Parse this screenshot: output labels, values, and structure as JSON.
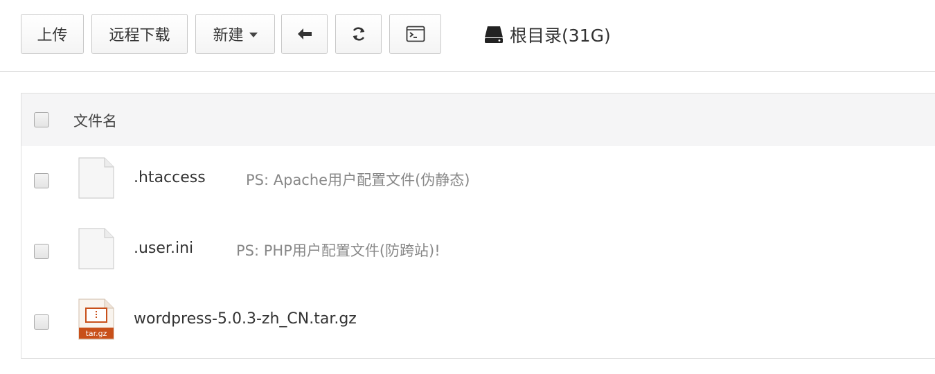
{
  "toolbar": {
    "upload_label": "上传",
    "remote_download_label": "远程下载",
    "new_label": "新建",
    "back_icon": "arrow-left-icon",
    "refresh_icon": "refresh-icon",
    "terminal_icon": "terminal-icon",
    "path_icon": "hdd-icon",
    "path_label": "根目录(31G)"
  },
  "table": {
    "header": {
      "name_label": "文件名"
    },
    "rows": [
      {
        "name": ".htaccess",
        "note": "PS: Apache用户配置文件(伪静态)",
        "icon": "file-icon"
      },
      {
        "name": ".user.ini",
        "note": "PS: PHP用户配置文件(防跨站)!",
        "icon": "file-icon"
      },
      {
        "name": "wordpress-5.0.3-zh_CN.tar.gz",
        "note": "",
        "icon": "archive-icon",
        "icon_badge": "tar.gz"
      }
    ]
  },
  "colors": {
    "border": "#c8c8c8",
    "header_bg": "#f5f5f6",
    "note_text": "#888888",
    "archive_accent": "#c8501a"
  }
}
